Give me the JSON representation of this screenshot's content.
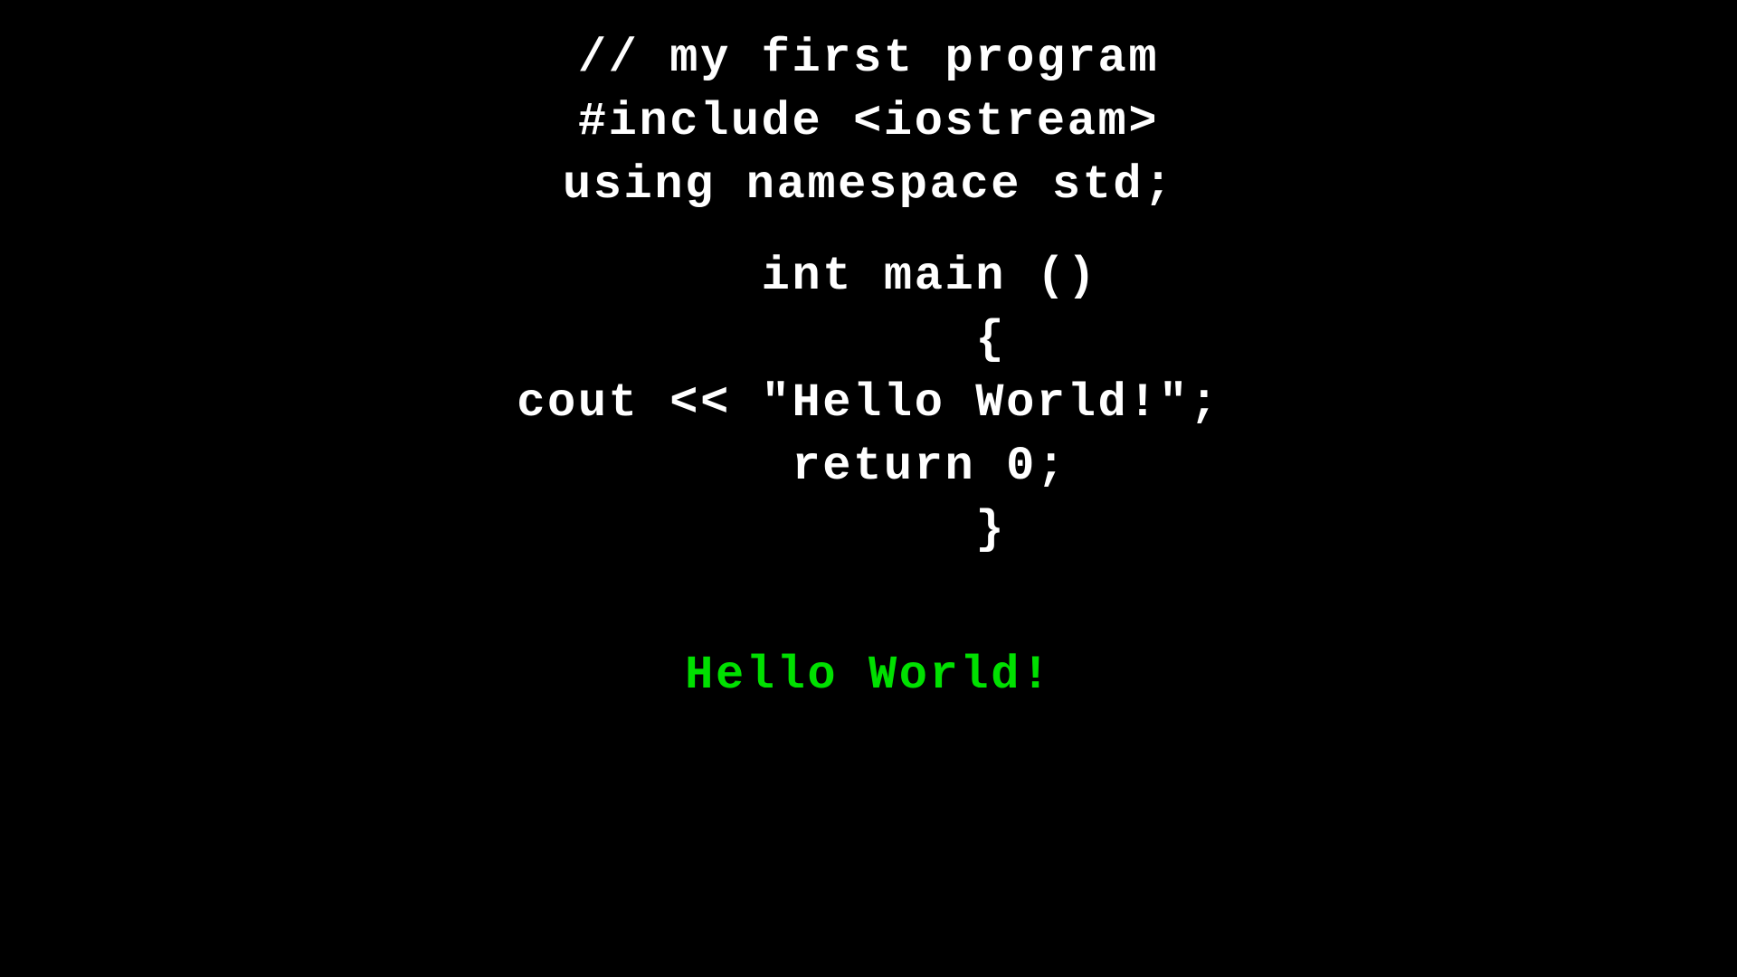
{
  "code": {
    "lines": [
      {
        "id": "comment",
        "text": "// my first program",
        "type": "code"
      },
      {
        "id": "include",
        "text": "#include <iostream>",
        "type": "code"
      },
      {
        "id": "using",
        "text": "using namespace std;",
        "type": "code"
      },
      {
        "id": "spacer1",
        "text": "",
        "type": "spacer"
      },
      {
        "id": "main",
        "text": "    int main ()",
        "type": "code"
      },
      {
        "id": "open-brace",
        "text": "        {",
        "type": "code"
      },
      {
        "id": "cout",
        "text": "cout << \"Hello World!\";",
        "type": "code"
      },
      {
        "id": "return",
        "text": "    return 0;",
        "type": "code"
      },
      {
        "id": "close-brace",
        "text": "        }",
        "type": "code"
      },
      {
        "id": "spacer2",
        "text": "",
        "type": "spacer"
      },
      {
        "id": "output",
        "text": "Hello World!",
        "type": "output"
      }
    ]
  }
}
